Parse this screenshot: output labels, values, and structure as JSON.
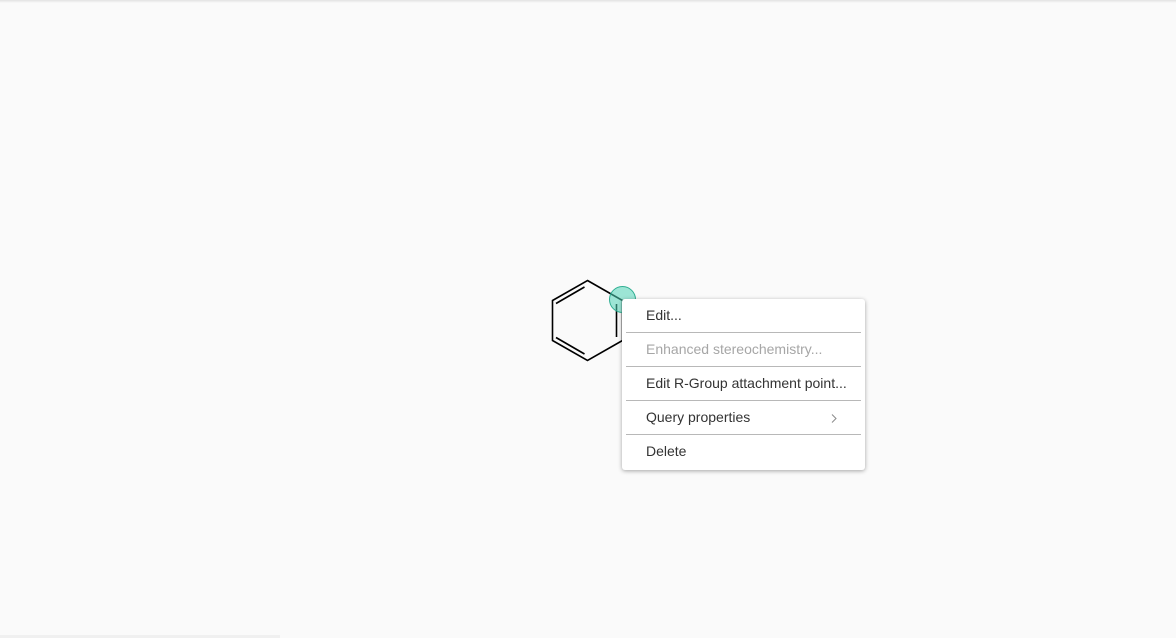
{
  "canvas": {
    "name": "chemical-structure-canvas"
  },
  "molecule": {
    "name": "benzene-ring",
    "highlight_color": "#4fd3b6"
  },
  "context_menu": {
    "items": [
      {
        "label": "Edit...",
        "enabled": true
      },
      {
        "label": "Enhanced stereochemistry...",
        "enabled": false
      },
      {
        "label": "Edit R-Group attachment point...",
        "enabled": true
      },
      {
        "label": "Query properties",
        "enabled": true,
        "submenu": true,
        "icon": "chevron-right-icon"
      },
      {
        "label": "Delete",
        "enabled": true
      }
    ]
  }
}
